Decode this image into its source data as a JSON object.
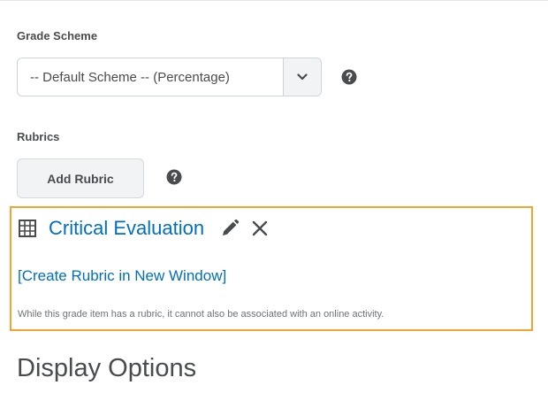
{
  "grade_scheme": {
    "label": "Grade Scheme",
    "selected": "-- Default Scheme -- (Percentage)"
  },
  "rubrics": {
    "label": "Rubrics",
    "add_button_label": "Add Rubric",
    "attached": {
      "name": "Critical Evaluation",
      "create_link": "[Create Rubric in New Window]",
      "note": "While this grade item has a rubric, it cannot also be associated with an online activity."
    }
  },
  "display_options": {
    "heading": "Display Options"
  },
  "colors": {
    "link": "#006fbf",
    "highlight_border": "#f1a52f",
    "text": "#494c4e"
  }
}
